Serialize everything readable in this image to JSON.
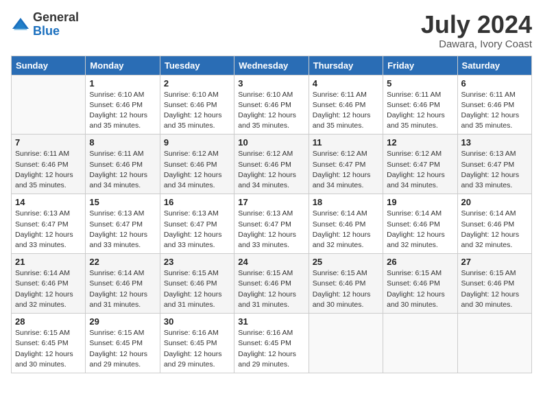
{
  "header": {
    "logo_line1": "General",
    "logo_line2": "Blue",
    "month_year": "July 2024",
    "location": "Dawara, Ivory Coast"
  },
  "weekdays": [
    "Sunday",
    "Monday",
    "Tuesday",
    "Wednesday",
    "Thursday",
    "Friday",
    "Saturday"
  ],
  "weeks": [
    [
      {
        "day": "",
        "info": ""
      },
      {
        "day": "1",
        "info": "Sunrise: 6:10 AM\nSunset: 6:46 PM\nDaylight: 12 hours\nand 35 minutes."
      },
      {
        "day": "2",
        "info": "Sunrise: 6:10 AM\nSunset: 6:46 PM\nDaylight: 12 hours\nand 35 minutes."
      },
      {
        "day": "3",
        "info": "Sunrise: 6:10 AM\nSunset: 6:46 PM\nDaylight: 12 hours\nand 35 minutes."
      },
      {
        "day": "4",
        "info": "Sunrise: 6:11 AM\nSunset: 6:46 PM\nDaylight: 12 hours\nand 35 minutes."
      },
      {
        "day": "5",
        "info": "Sunrise: 6:11 AM\nSunset: 6:46 PM\nDaylight: 12 hours\nand 35 minutes."
      },
      {
        "day": "6",
        "info": "Sunrise: 6:11 AM\nSunset: 6:46 PM\nDaylight: 12 hours\nand 35 minutes."
      }
    ],
    [
      {
        "day": "7",
        "info": "Sunrise: 6:11 AM\nSunset: 6:46 PM\nDaylight: 12 hours\nand 35 minutes."
      },
      {
        "day": "8",
        "info": "Sunrise: 6:11 AM\nSunset: 6:46 PM\nDaylight: 12 hours\nand 34 minutes."
      },
      {
        "day": "9",
        "info": "Sunrise: 6:12 AM\nSunset: 6:46 PM\nDaylight: 12 hours\nand 34 minutes."
      },
      {
        "day": "10",
        "info": "Sunrise: 6:12 AM\nSunset: 6:46 PM\nDaylight: 12 hours\nand 34 minutes."
      },
      {
        "day": "11",
        "info": "Sunrise: 6:12 AM\nSunset: 6:47 PM\nDaylight: 12 hours\nand 34 minutes."
      },
      {
        "day": "12",
        "info": "Sunrise: 6:12 AM\nSunset: 6:47 PM\nDaylight: 12 hours\nand 34 minutes."
      },
      {
        "day": "13",
        "info": "Sunrise: 6:13 AM\nSunset: 6:47 PM\nDaylight: 12 hours\nand 33 minutes."
      }
    ],
    [
      {
        "day": "14",
        "info": "Sunrise: 6:13 AM\nSunset: 6:47 PM\nDaylight: 12 hours\nand 33 minutes."
      },
      {
        "day": "15",
        "info": "Sunrise: 6:13 AM\nSunset: 6:47 PM\nDaylight: 12 hours\nand 33 minutes."
      },
      {
        "day": "16",
        "info": "Sunrise: 6:13 AM\nSunset: 6:47 PM\nDaylight: 12 hours\nand 33 minutes."
      },
      {
        "day": "17",
        "info": "Sunrise: 6:13 AM\nSunset: 6:47 PM\nDaylight: 12 hours\nand 33 minutes."
      },
      {
        "day": "18",
        "info": "Sunrise: 6:14 AM\nSunset: 6:46 PM\nDaylight: 12 hours\nand 32 minutes."
      },
      {
        "day": "19",
        "info": "Sunrise: 6:14 AM\nSunset: 6:46 PM\nDaylight: 12 hours\nand 32 minutes."
      },
      {
        "day": "20",
        "info": "Sunrise: 6:14 AM\nSunset: 6:46 PM\nDaylight: 12 hours\nand 32 minutes."
      }
    ],
    [
      {
        "day": "21",
        "info": "Sunrise: 6:14 AM\nSunset: 6:46 PM\nDaylight: 12 hours\nand 32 minutes."
      },
      {
        "day": "22",
        "info": "Sunrise: 6:14 AM\nSunset: 6:46 PM\nDaylight: 12 hours\nand 31 minutes."
      },
      {
        "day": "23",
        "info": "Sunrise: 6:15 AM\nSunset: 6:46 PM\nDaylight: 12 hours\nand 31 minutes."
      },
      {
        "day": "24",
        "info": "Sunrise: 6:15 AM\nSunset: 6:46 PM\nDaylight: 12 hours\nand 31 minutes."
      },
      {
        "day": "25",
        "info": "Sunrise: 6:15 AM\nSunset: 6:46 PM\nDaylight: 12 hours\nand 30 minutes."
      },
      {
        "day": "26",
        "info": "Sunrise: 6:15 AM\nSunset: 6:46 PM\nDaylight: 12 hours\nand 30 minutes."
      },
      {
        "day": "27",
        "info": "Sunrise: 6:15 AM\nSunset: 6:46 PM\nDaylight: 12 hours\nand 30 minutes."
      }
    ],
    [
      {
        "day": "28",
        "info": "Sunrise: 6:15 AM\nSunset: 6:45 PM\nDaylight: 12 hours\nand 30 minutes."
      },
      {
        "day": "29",
        "info": "Sunrise: 6:15 AM\nSunset: 6:45 PM\nDaylight: 12 hours\nand 29 minutes."
      },
      {
        "day": "30",
        "info": "Sunrise: 6:16 AM\nSunset: 6:45 PM\nDaylight: 12 hours\nand 29 minutes."
      },
      {
        "day": "31",
        "info": "Sunrise: 6:16 AM\nSunset: 6:45 PM\nDaylight: 12 hours\nand 29 minutes."
      },
      {
        "day": "",
        "info": ""
      },
      {
        "day": "",
        "info": ""
      },
      {
        "day": "",
        "info": ""
      }
    ]
  ]
}
